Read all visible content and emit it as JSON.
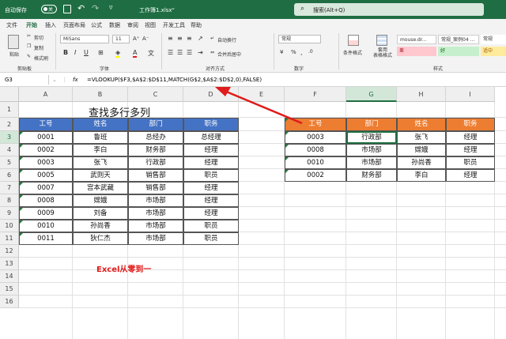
{
  "titlebar": {
    "autosave": "自动保存",
    "autosave_state": "关",
    "doc_title": "工作簿1.xlsx",
    "search_placeholder": "搜索(Alt+Q)"
  },
  "menu": [
    "文件",
    "开始",
    "插入",
    "页面布局",
    "公式",
    "数据",
    "审阅",
    "视图",
    "开发工具",
    "帮助"
  ],
  "ribbon": {
    "paste": "粘贴",
    "cut": "剪切",
    "copy": "复制",
    "format_painter": "格式刷",
    "clipboard": "剪贴板",
    "font_name": "MiSans",
    "font_size": "11",
    "font_group": "字体",
    "wrap": "自动换行",
    "merge": "合并后居中",
    "align_group": "对齐方式",
    "number_format": "常规",
    "number_group": "数字",
    "cond_format": "条件格式",
    "table_format": "套用\n表格格式",
    "style_group": "样式",
    "styles": [
      "mouse.dr...",
      "常规_案例04 ...",
      "常规",
      "差",
      "好",
      "适中"
    ]
  },
  "formula": {
    "namebox": "G3",
    "fx": "fx",
    "text": "=VLOOKUP($F3,$A$2:$D$11,MATCH(G$2,$A$2:$D$2,0),FALSE)"
  },
  "columns": [
    "A",
    "B",
    "C",
    "D",
    "E",
    "F",
    "G",
    "H",
    "I"
  ],
  "rows": [
    "1",
    "2",
    "3",
    "4",
    "5",
    "6",
    "7",
    "8",
    "9",
    "10",
    "11",
    "12",
    "13",
    "14",
    "15",
    "16"
  ],
  "sheet": {
    "title": "查找多行多列",
    "left_headers": [
      "工号",
      "姓名",
      "部门",
      "职务"
    ],
    "left_rows": [
      [
        "0001",
        "鲁班",
        "总经办",
        "总经理"
      ],
      [
        "0002",
        "李白",
        "财务部",
        "经理"
      ],
      [
        "0003",
        "张飞",
        "行政部",
        "经理"
      ],
      [
        "0005",
        "武则天",
        "销售部",
        "职员"
      ],
      [
        "0007",
        "宫本武藏",
        "销售部",
        "经理"
      ],
      [
        "0008",
        "嫦娥",
        "市场部",
        "经理"
      ],
      [
        "0009",
        "刘备",
        "市场部",
        "经理"
      ],
      [
        "0010",
        "孙尚香",
        "市场部",
        "职员"
      ],
      [
        "0011",
        "狄仁杰",
        "市场部",
        "职员"
      ]
    ],
    "right_headers": [
      "工号",
      "部门",
      "姓名",
      "职务"
    ],
    "right_rows": [
      [
        "0003",
        "行政部",
        "张飞",
        "经理"
      ],
      [
        "0008",
        "市场部",
        "嫦娥",
        "经理"
      ],
      [
        "0010",
        "市场部",
        "孙尚香",
        "职员"
      ],
      [
        "0002",
        "财务部",
        "李白",
        "经理"
      ]
    ],
    "watermark": "Excel从零到一"
  },
  "colors": {
    "excel_green": "#1f6e43",
    "blue_header": "#4472c4",
    "orange_header": "#ed7d31",
    "arrow_red": "#e01b1b"
  }
}
